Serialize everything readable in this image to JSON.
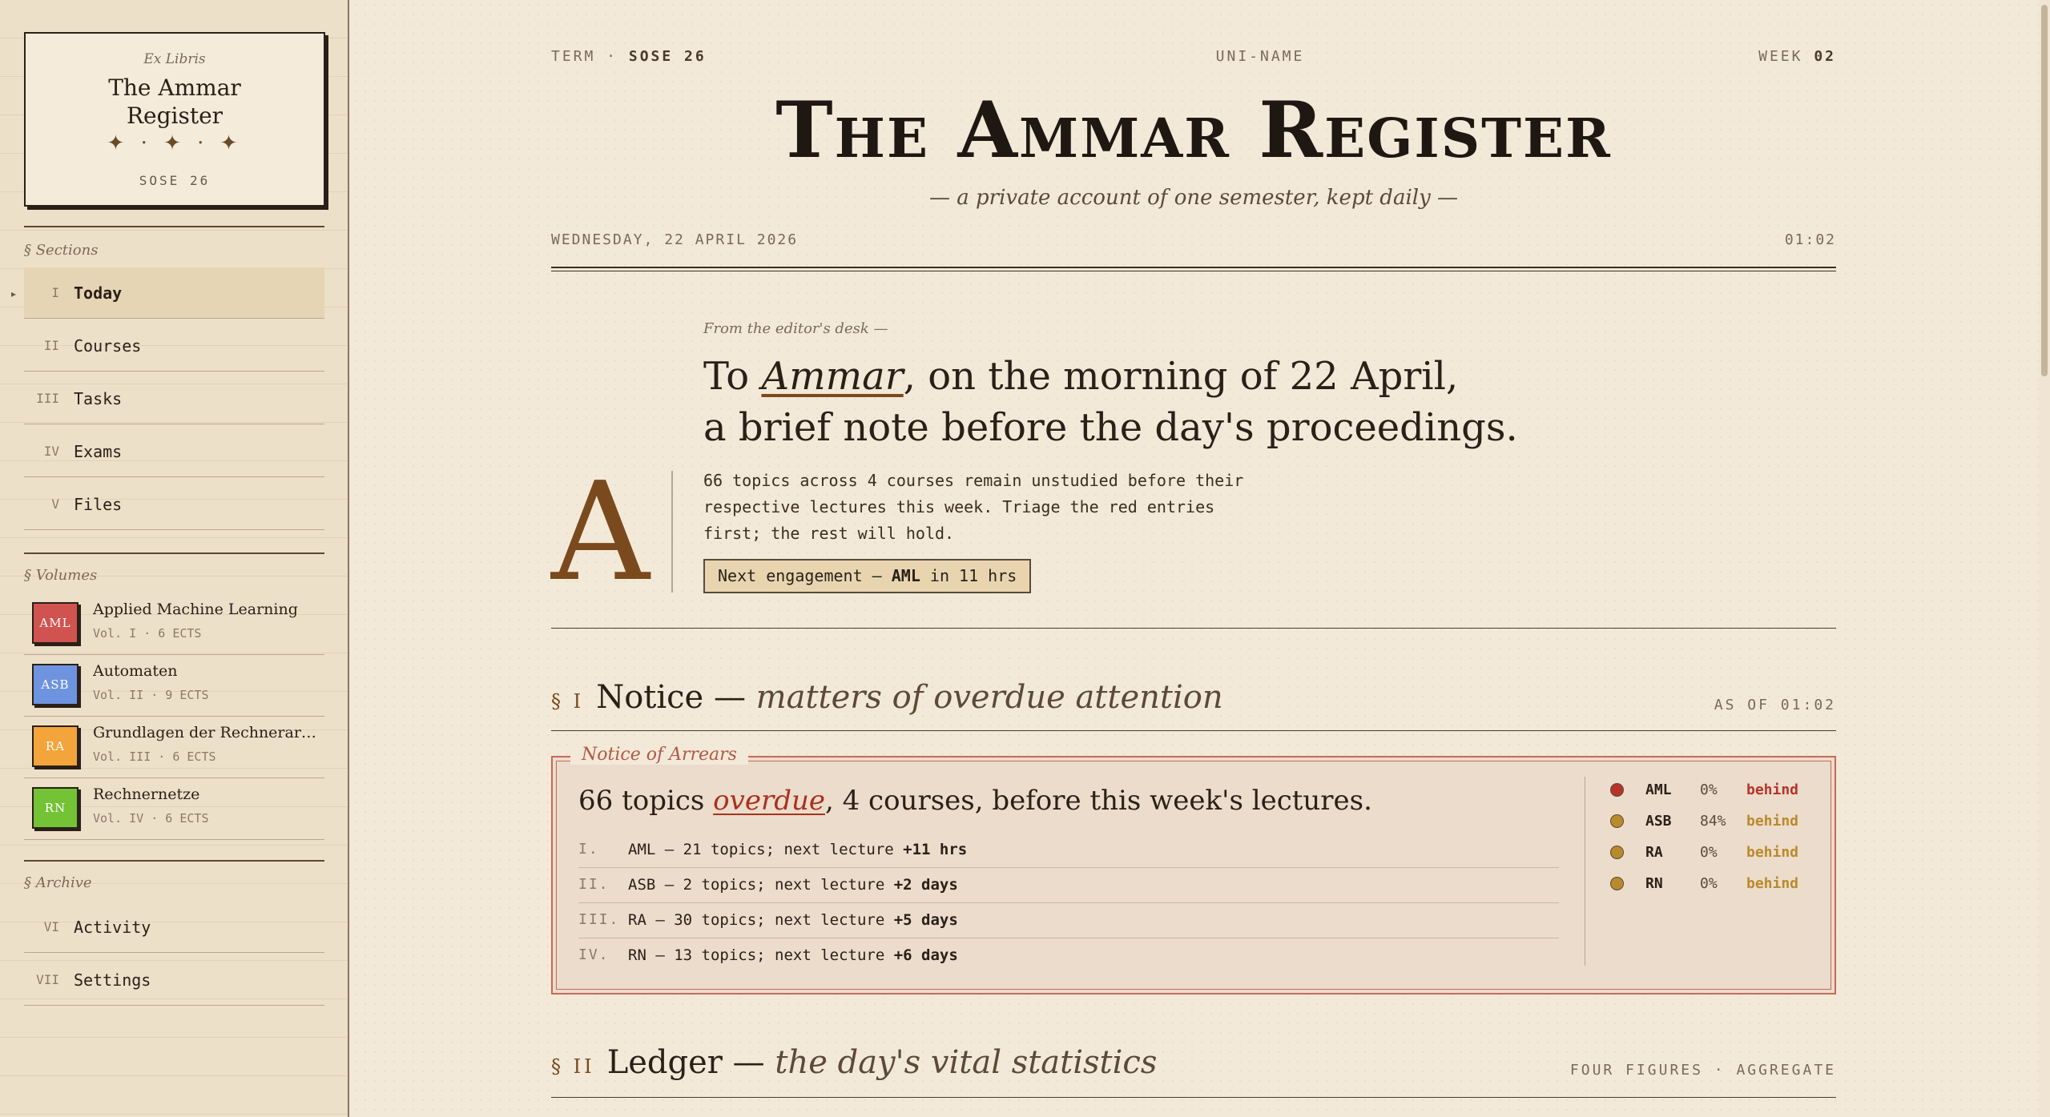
{
  "sidebar": {
    "exlibris": {
      "tag": "Ex Libris",
      "name_line1": "The Ammar",
      "name_line2": "Register",
      "ornament": "✦ · ✦ · ✦",
      "term": "SOSE 26"
    },
    "sections_heading": "§ Sections",
    "sections": [
      {
        "num": "I",
        "label": "Today",
        "active": true
      },
      {
        "num": "II",
        "label": "Courses"
      },
      {
        "num": "III",
        "label": "Tasks"
      },
      {
        "num": "IV",
        "label": "Exams"
      },
      {
        "num": "V",
        "label": "Files"
      }
    ],
    "volumes_heading": "§ Volumes",
    "volumes": [
      {
        "code": "AML",
        "title": "Applied Machine Learning",
        "meta": "Vol. I · 6 ECTS",
        "color": "#d0534f"
      },
      {
        "code": "ASB",
        "title": "Automaten",
        "meta": "Vol. II · 9 ECTS",
        "color": "#6e94e0"
      },
      {
        "code": "RA",
        "title": "Grundlagen der Rechnerarc...",
        "meta": "Vol. III · 6 ECTS",
        "color": "#f3a43a"
      },
      {
        "code": "RN",
        "title": "Rechnernetze",
        "meta": "Vol. IV · 6 ECTS",
        "color": "#74c236"
      }
    ],
    "archive_heading": "§ Archive",
    "archive": [
      {
        "num": "VI",
        "label": "Activity"
      },
      {
        "num": "VII",
        "label": "Settings"
      }
    ]
  },
  "header": {
    "term_label": "TERM · ",
    "term_value": "SOSE 26",
    "uni": "UNI-NAME",
    "week_label": "WEEK ",
    "week_value": "02",
    "masthead": "The Ammar Register",
    "tagline": "— a private account of one semester, kept daily —",
    "date": "WEDNESDAY, 22 APRIL 2026",
    "time": "01:02"
  },
  "editor": {
    "desk": "From the editor's desk —",
    "greet_prefix": "To ",
    "greet_name": "Ammar",
    "greet_rest_1": ", on the morning of 22 April,",
    "greet_line2": "a brief note before the day's proceedings.",
    "dropcap": "A",
    "body": "66 topics across 4 courses remain unstudied before their respective lectures this week. Triage the red entries first; the rest will hold.",
    "engage_prefix": "Next engagement — ",
    "engage_course": "AML",
    "engage_suffix": " in 11 hrs"
  },
  "notice": {
    "num": "§ I",
    "title": "Notice",
    "dash": " — ",
    "subtitle": "matters of overdue attention",
    "asof": "AS OF 01:02",
    "legend": "Notice of Arrears",
    "headline_pre": "66 topics ",
    "headline_em": "overdue",
    "headline_post": ", 4 courses, before this week's lectures.",
    "rows": [
      {
        "n": "I.",
        "text": "AML — 21 topics; next lecture ",
        "bold": "+11 hrs"
      },
      {
        "n": "II.",
        "text": "ASB — 2 topics; next lecture ",
        "bold": "+2 days"
      },
      {
        "n": "III.",
        "text": "RA — 30 topics; next lecture ",
        "bold": "+5 days"
      },
      {
        "n": "IV.",
        "text": "RN — 13 topics; next lecture ",
        "bold": "+6 days"
      }
    ],
    "status": [
      {
        "code": "AML",
        "pct": "0%",
        "state": "behind",
        "dot": "#b5342a",
        "state_color": "#b5342a"
      },
      {
        "code": "ASB",
        "pct": "84%",
        "state": "behind",
        "dot": "#b98a2c",
        "state_color": "#b98a2c"
      },
      {
        "code": "RA",
        "pct": "0%",
        "state": "behind",
        "dot": "#b98a2c",
        "state_color": "#b98a2c"
      },
      {
        "code": "RN",
        "pct": "0%",
        "state": "behind",
        "dot": "#b98a2c",
        "state_color": "#b98a2c"
      }
    ]
  },
  "ledger": {
    "num": "§ II",
    "title": "Ledger",
    "dash": " — ",
    "subtitle": "the day's vital statistics",
    "right": "FOUR FIGURES · AGGREGATE"
  }
}
